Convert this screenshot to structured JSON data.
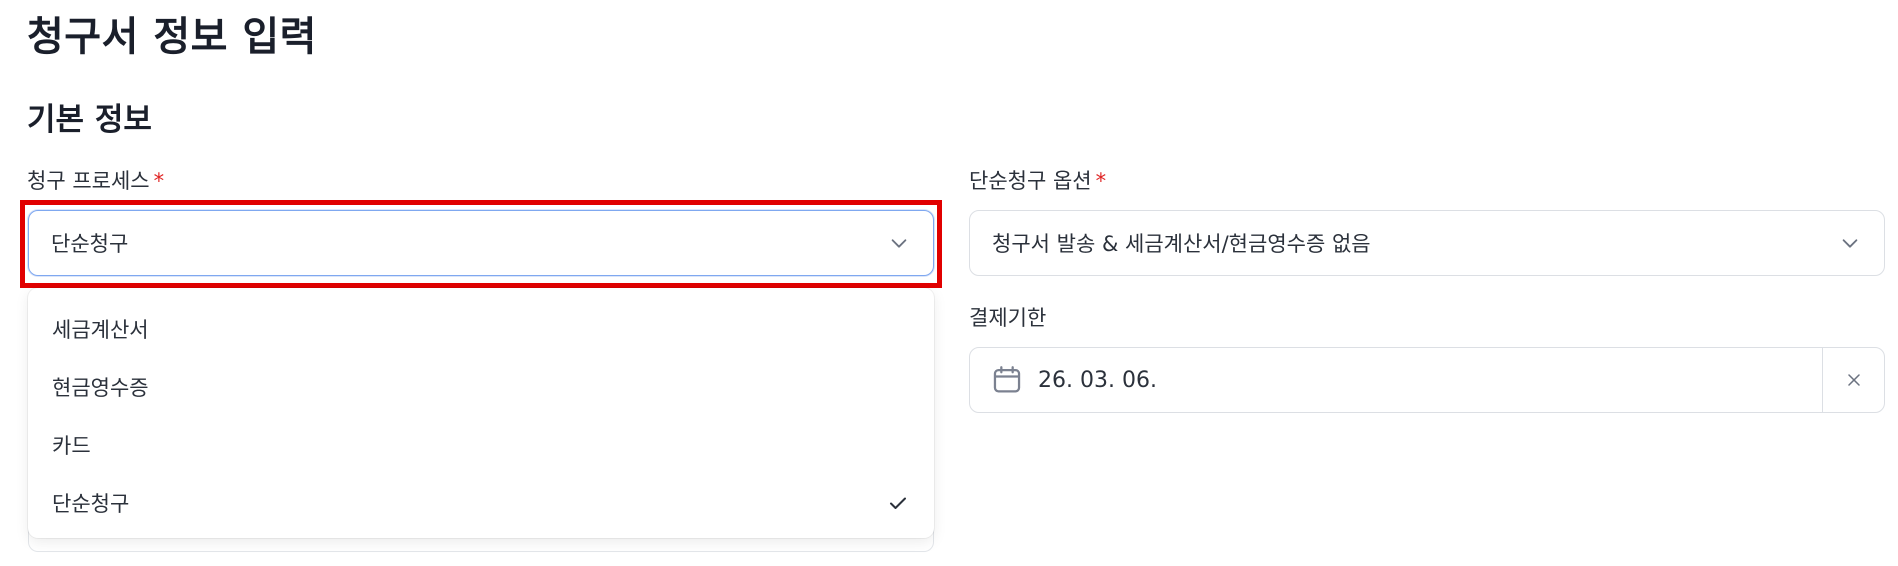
{
  "page": {
    "title": "청구서 정보 입력"
  },
  "section": {
    "title": "기본 정보"
  },
  "billing_process": {
    "label": "청구 프로세스",
    "required_mark": "*",
    "selected": "단순청구",
    "options": [
      {
        "label": "세금계산서",
        "selected": false
      },
      {
        "label": "현금영수증",
        "selected": false
      },
      {
        "label": "카드",
        "selected": false
      },
      {
        "label": "단순청구",
        "selected": true
      }
    ]
  },
  "simple_billing_option": {
    "label": "단순청구 옵션",
    "required_mark": "*",
    "selected": "청구서 발송 & 세금계산서/현금영수증 없음"
  },
  "due_date": {
    "label": "결제기한",
    "value": "26. 03. 06."
  },
  "colors": {
    "highlight": "#e10000",
    "required": "#e02424",
    "focus_border": "#7fa8f0"
  },
  "icons": {
    "chevron": "chevron-down-icon",
    "check": "check-icon",
    "calendar": "calendar-icon",
    "clear": "close-icon"
  }
}
